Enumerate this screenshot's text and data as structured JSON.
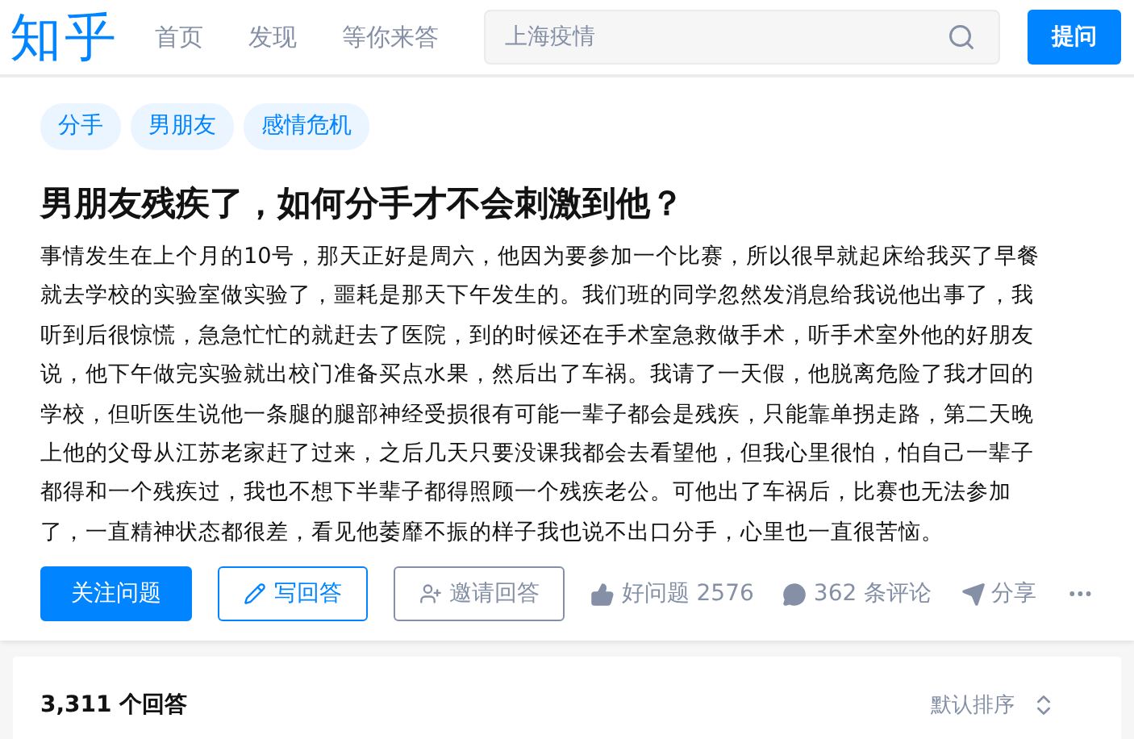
{
  "header": {
    "logo": "知乎",
    "nav": [
      {
        "label": "首页",
        "selected": false
      },
      {
        "label": "发现",
        "selected": false
      },
      {
        "label": "等你来答",
        "selected": false
      }
    ],
    "search": {
      "value": "上海疫情"
    },
    "ask_button": "提问"
  },
  "question": {
    "topics": [
      "分手",
      "男朋友",
      "感情危机"
    ],
    "title": "男朋友残疾了，如何分手才不会刺激到他？",
    "body_lines": [
      "事情发生在上个月的10号，那天正好是周六，他因为要参加一个比赛，所以很早就起床给我买了早餐",
      "就去学校的实验室做实验了，噩耗是那天下午发生的。我们班的同学忽然发消息给我说他出事了，我",
      "听到后很惊慌，急急忙忙的就赶去了医院，到的时候还在手术室急救做手术，听手术室外他的好朋友",
      "说，他下午做完实验就出校门准备买点水果，然后出了车祸。我请了一天假，他脱离危险了我才回的",
      "学校，但听医生说他一条腿的腿部神经受损很有可能一辈子都会是残疾，只能靠单拐走路，第二天晚",
      "上他的父母从江苏老家赶了过来，之后几天只要没课我都会去看望他，但我心里很怕，怕自己一辈子",
      "都得和一个残疾过，我也不想下半辈子都得照顾一个残疾老公。可他出了车祸后，比赛也无法参加",
      "了，一直精神状态都很差，看见他萎靡不振的样子我也说不出口分手，心里也一直很苦恼。"
    ],
    "actions": {
      "follow": "关注问题",
      "write": "写回答",
      "invite": "邀请回答",
      "good_question": "好问题 2576",
      "comments": "362 条评论",
      "share": "分享"
    }
  },
  "answers": {
    "count": "3,311 个回答",
    "sort": "默认排序"
  }
}
